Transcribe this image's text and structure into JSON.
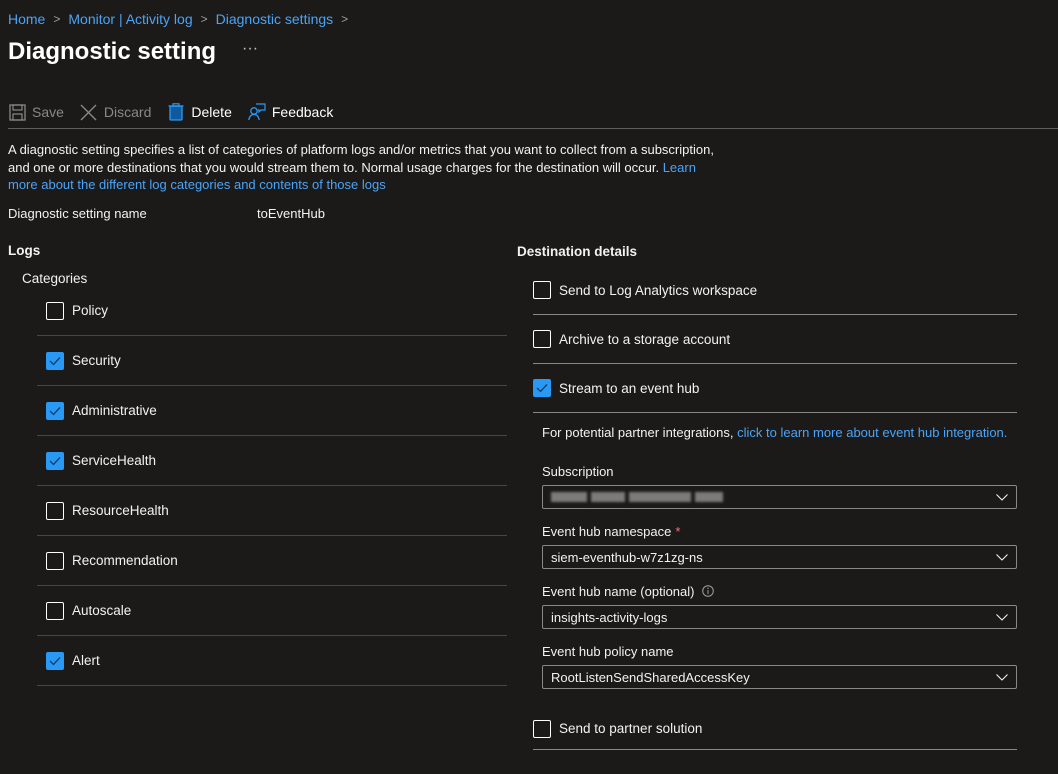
{
  "breadcrumb": [
    {
      "label": "Home"
    },
    {
      "label": "Monitor | Activity log"
    },
    {
      "label": "Diagnostic settings"
    }
  ],
  "header": {
    "title": "Diagnostic setting",
    "more_label": "···"
  },
  "toolbar": {
    "save_label": "Save",
    "discard_label": "Discard",
    "delete_label": "Delete",
    "feedback_label": "Feedback"
  },
  "description": {
    "text": "A diagnostic setting specifies a list of categories of platform logs and/or metrics that you want to collect from a subscription, and one or more destinations that you would stream them to. Normal usage charges for the destination will occur.",
    "link": "Learn more about the different log categories and contents of those logs"
  },
  "setting_name": {
    "label": "Diagnostic setting name",
    "value": "toEventHub"
  },
  "logs": {
    "title": "Logs",
    "categories_label": "Categories",
    "categories": [
      {
        "label": "Policy",
        "checked": false
      },
      {
        "label": "Security",
        "checked": true
      },
      {
        "label": "Administrative",
        "checked": true
      },
      {
        "label": "ServiceHealth",
        "checked": true
      },
      {
        "label": "ResourceHealth",
        "checked": false
      },
      {
        "label": "Recommendation",
        "checked": false
      },
      {
        "label": "Autoscale",
        "checked": false
      },
      {
        "label": "Alert",
        "checked": true
      }
    ]
  },
  "destination": {
    "title": "Destination details",
    "options": [
      {
        "label": "Send to Log Analytics workspace",
        "checked": false
      },
      {
        "label": "Archive to a storage account",
        "checked": false
      },
      {
        "label": "Stream to an event hub",
        "checked": true
      }
    ],
    "event_hub": {
      "partner_text": "For potential partner integrations,",
      "partner_link": "click to learn more about event hub integration.",
      "subscription": {
        "label": "Subscription",
        "value": "(redacted)"
      },
      "namespace": {
        "label": "Event hub namespace",
        "required_mark": "*",
        "value": "siem-eventhub-w7z1zg-ns"
      },
      "hub_name": {
        "label": "Event hub name (optional)",
        "value": "insights-activity-logs"
      },
      "policy": {
        "label": "Event hub policy name",
        "value": "RootListenSendSharedAccessKey"
      }
    },
    "partner_solution": {
      "label": "Send to partner solution",
      "checked": false
    }
  },
  "colors": {
    "background": "#1b1a19",
    "link": "#4ba3f7",
    "checkbox_checked": "#2899f5",
    "required": "#f1707b"
  }
}
